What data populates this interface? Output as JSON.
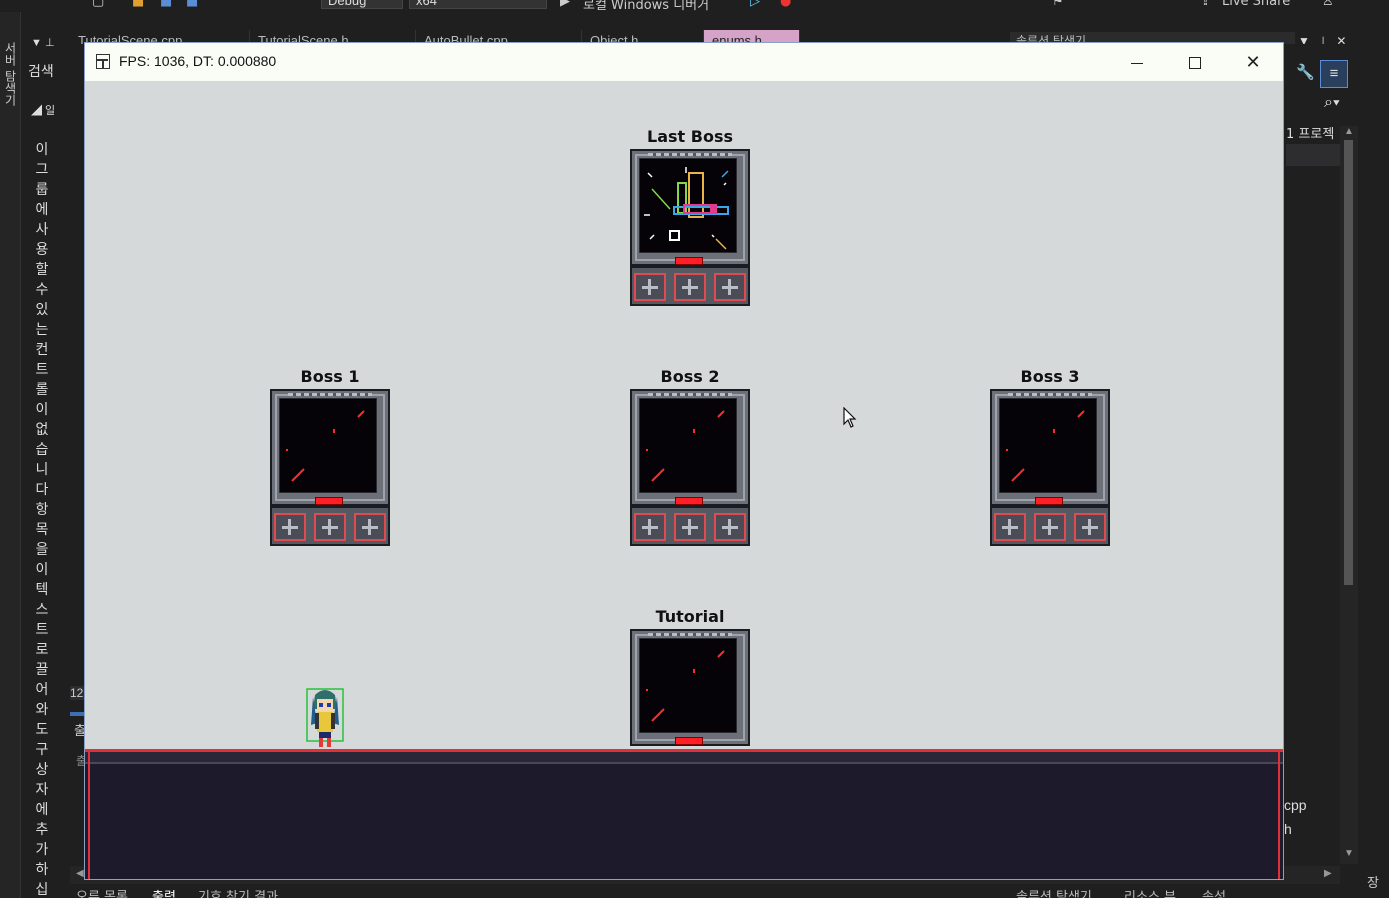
{
  "ide": {
    "toolbar": {
      "config": "Debug",
      "platform": "x64",
      "run_target": "로컬 Windows 디버거",
      "live_share": "Live Share"
    },
    "left_rail_text": "서버 탐색기",
    "left_panel": {
      "search_label": "검색",
      "empty_message": "이그룹에사용할수있는컨트롤이없습니다항목을이텍스트로끌어와도구상자에추가하십시"
    },
    "tabs": [
      "TutorialScene.cpp",
      "TutorialScene.h",
      "AutoBullet.cpp",
      "Object.h",
      "enums.h"
    ],
    "tab_search": "솔루션 탐색기",
    "right_panel": {
      "title": "1 프로젝",
      "files": [
        "cpp",
        "h"
      ]
    },
    "side_number": "12",
    "side_text_1": "출",
    "side_text_2": "출",
    "bottom_tabs": [
      "오류 목록",
      "출력",
      "기호 찾기 결과"
    ],
    "bottom_right_tabs": [
      "솔루션 탐색기",
      "리소스 뷰",
      "속성"
    ],
    "right_edge_text": "장"
  },
  "game_window": {
    "title": "FPS: 1036, DT: 0.000880",
    "stages": [
      {
        "id": "last-boss",
        "label": "Last Boss"
      },
      {
        "id": "boss-1",
        "label": "Boss 1"
      },
      {
        "id": "boss-2",
        "label": "Boss 2"
      },
      {
        "id": "boss-3",
        "label": "Boss 3"
      },
      {
        "id": "tutorial",
        "label": "Tutorial"
      }
    ]
  },
  "colors": {
    "background": "#d5d9d9",
    "ground": "#1d1a2c",
    "accent_red": "#e23038",
    "screen": "#050208"
  }
}
